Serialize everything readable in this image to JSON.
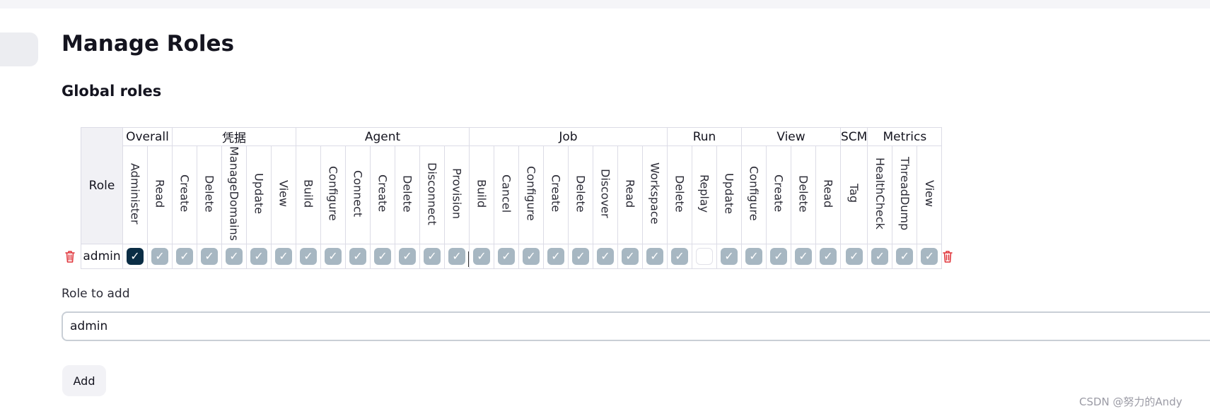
{
  "page_title": "Manage Roles",
  "section_title": "Global roles",
  "table": {
    "role_header": "Role",
    "groups": [
      {
        "label": "Overall",
        "permissions": [
          "Administer",
          "Read"
        ]
      },
      {
        "label": "凭据",
        "permissions": [
          "Create",
          "Delete",
          "ManageDomains",
          "Update",
          "View"
        ]
      },
      {
        "label": "Agent",
        "permissions": [
          "Build",
          "Configure",
          "Connect",
          "Create",
          "Delete",
          "Disconnect",
          "Provision"
        ]
      },
      {
        "label": "Job",
        "permissions": [
          "Build",
          "Cancel",
          "Configure",
          "Create",
          "Delete",
          "Discover",
          "Read",
          "Workspace"
        ]
      },
      {
        "label": "Run",
        "permissions": [
          "Delete",
          "Replay",
          "Update"
        ]
      },
      {
        "label": "View",
        "permissions": [
          "Configure",
          "Create",
          "Delete",
          "Read"
        ]
      },
      {
        "label": "SCM",
        "permissions": [
          "Tag"
        ]
      },
      {
        "label": "Metrics",
        "permissions": [
          "HealthCheck",
          "ThreadDump",
          "View"
        ]
      }
    ],
    "rows": [
      {
        "name": "admin",
        "checked": [
          true,
          true,
          true,
          true,
          true,
          true,
          true,
          true,
          true,
          true,
          true,
          true,
          true,
          true,
          true,
          true,
          true,
          true,
          true,
          true,
          true,
          true,
          true,
          false,
          true,
          true,
          true,
          true,
          true,
          true,
          true,
          true,
          true
        ]
      }
    ]
  },
  "add_role": {
    "label": "Role to add",
    "value": "admin",
    "button_label": "Add"
  },
  "watermark": "CSDN @努力的Andy",
  "icons": {
    "delete": "trash-icon",
    "check": "checkmark-icon"
  },
  "colors": {
    "checkbox_checked": "#a7b7c2",
    "checkbox_primary": "#0a2d45",
    "trash": "#e0363c"
  }
}
